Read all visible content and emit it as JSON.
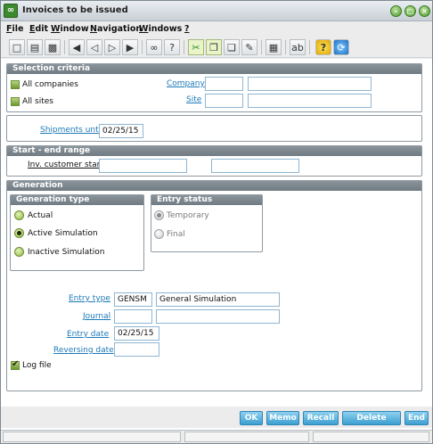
{
  "window": {
    "title": "Invoices to be issued"
  },
  "menu": [
    {
      "label": "File",
      "underline": "F",
      "rest": "ile"
    },
    {
      "label": "Edit",
      "underline": "E",
      "rest": "dit"
    },
    {
      "label": "Window",
      "underline": "W",
      "rest": "indow"
    },
    {
      "label": "Navigation",
      "underline": "N",
      "rest": "avigation"
    },
    {
      "label": "Windows",
      "underline": "W",
      "rest": "indows"
    },
    {
      "label": "?",
      "underline": "?",
      "rest": ""
    }
  ],
  "selection_criteria": {
    "title": "Selection criteria",
    "all_companies_label": "All companies",
    "all_sites_label": "All sites",
    "company_label": "Company",
    "site_label": "Site",
    "company_value": "",
    "company_desc": "",
    "site_value": "",
    "site_desc": ""
  },
  "shipments": {
    "label": "Shipments until",
    "value": "02/25/15"
  },
  "range": {
    "title": "Start - end range",
    "customer_label": "Inv. customer start",
    "start_value": "",
    "end_value": ""
  },
  "generation": {
    "title": "Generation",
    "generation_type": {
      "title": "Generation type",
      "options": [
        "Actual",
        "Active Simulation",
        "Inactive Simulation"
      ],
      "selected": "Active Simulation"
    },
    "entry_status": {
      "title": "Entry status",
      "options": [
        "Temporary",
        "Final"
      ],
      "selected": "Temporary"
    },
    "entry_type_label": "Entry type",
    "entry_type_value": "GENSM",
    "entry_type_desc": "General Simulation",
    "journal_label": "Journal",
    "journal_value": "",
    "journal_desc": "",
    "entry_date_label": "Entry date",
    "entry_date_value": "02/25/15",
    "reversing_date_label": "Reversing date",
    "reversing_date_value": "",
    "log_file_label": "Log file",
    "log_file_checked": true
  },
  "footer": {
    "ok": "OK",
    "memo": "Memo",
    "recall": "Recall",
    "delete_memo": "Delete memo",
    "end": "End"
  },
  "colors": {
    "link": "#1d79b8",
    "section_header": "#7a848b",
    "button": "#3c9fd0",
    "field_border": "#8eb6d2"
  }
}
